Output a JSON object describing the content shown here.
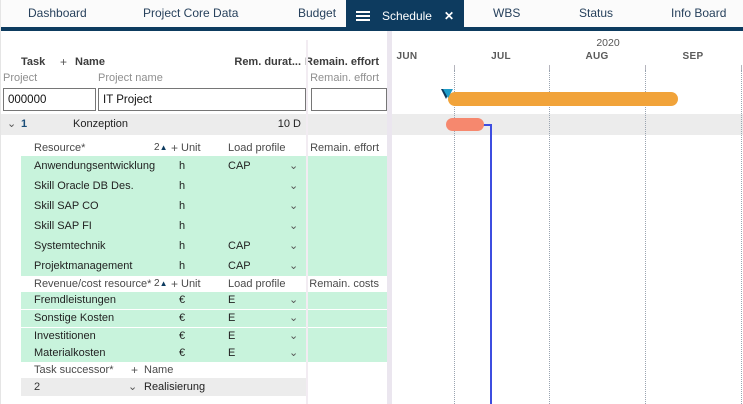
{
  "tabs": {
    "items": [
      "Dashboard",
      "Project Core Data",
      "Budget",
      "Schedule",
      "WBS",
      "Status",
      "Info Board"
    ],
    "active": "Schedule"
  },
  "icons": {
    "close": "✕",
    "dropdown": "⌄",
    "expand": "⌄",
    "add": "+",
    "sort_value": "2",
    "sort_asc": "▲"
  },
  "table": {
    "header": {
      "task": "Task",
      "plus": "+",
      "name": "Name",
      "rem_duration": "Rem. durat...",
      "remain_effort": "Remain. effort"
    },
    "subheader": {
      "project": "Project",
      "project_name": "Project name",
      "remain_effort": "Remain. effort"
    },
    "project_row": {
      "id": "000000",
      "name": "IT Project",
      "remain_effort": ""
    },
    "task_row": {
      "number": "1",
      "name": "Konzeption",
      "rem_duration": "10 D"
    }
  },
  "resources": {
    "header": {
      "label": "Resource*",
      "unit": "Unit",
      "load_profile": "Load profile",
      "remain": "Remain. effort"
    },
    "rows": [
      {
        "name": "Anwendungsentwicklung",
        "unit": "h",
        "load_profile": "CAP"
      },
      {
        "name": "Skill Oracle DB Des.",
        "unit": "h",
        "load_profile": ""
      },
      {
        "name": "Skill SAP CO",
        "unit": "h",
        "load_profile": ""
      },
      {
        "name": "Skill SAP FI",
        "unit": "h",
        "load_profile": ""
      },
      {
        "name": "Systemtechnik",
        "unit": "h",
        "load_profile": "CAP"
      },
      {
        "name": "Projektmanagement",
        "unit": "h",
        "load_profile": "CAP"
      }
    ]
  },
  "cost_resources": {
    "header": {
      "label": "Revenue/cost resource*",
      "unit": "Unit",
      "load_profile": "Load profile",
      "remain": "Remain. costs"
    },
    "rows": [
      {
        "name": "Fremdleistungen",
        "unit": "€",
        "load_profile": "E"
      },
      {
        "name": "Sonstige Kosten",
        "unit": "€",
        "load_profile": "E"
      },
      {
        "name": "Investitionen",
        "unit": "€",
        "load_profile": "E"
      },
      {
        "name": "Materialkosten",
        "unit": "€",
        "load_profile": "E"
      }
    ]
  },
  "successors": {
    "header": {
      "label": "Task successor*",
      "plus": "+",
      "name": "Name"
    },
    "rows": [
      {
        "number": "2",
        "name": "Realisierung"
      }
    ]
  },
  "gantt": {
    "year": "2020",
    "months": [
      "JUN",
      "JUL",
      "AUG",
      "SEP"
    ],
    "colors": {
      "project_bar": "#f1a33a",
      "task_bar": "#f6886e",
      "connector": "#3d4de0",
      "milestone": "#1e9dc9"
    }
  }
}
